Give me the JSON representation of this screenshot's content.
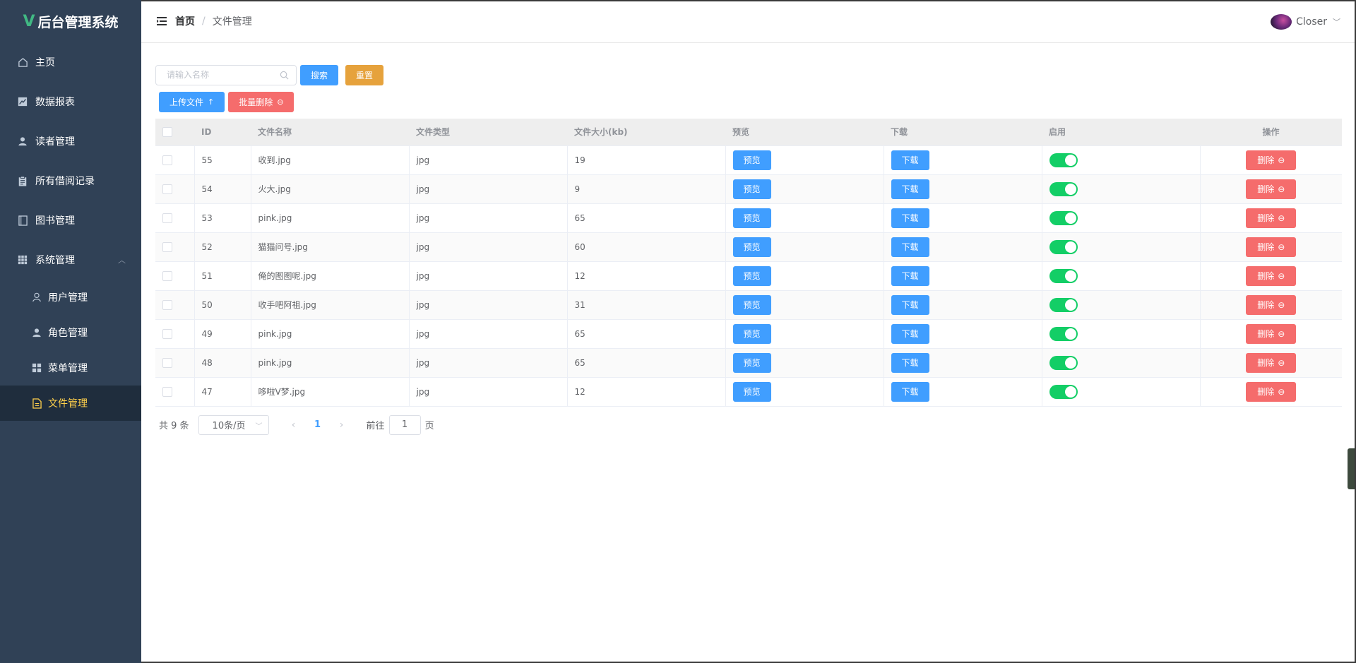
{
  "app": {
    "title": "后台管理系统",
    "logo_letter": "V"
  },
  "sidebar": {
    "items": [
      {
        "label": "主页",
        "icon": "home-icon"
      },
      {
        "label": "数据报表",
        "icon": "chart-icon"
      },
      {
        "label": "读者管理",
        "icon": "user-icon"
      },
      {
        "label": "所有借阅记录",
        "icon": "clipboard-icon"
      },
      {
        "label": "图书管理",
        "icon": "book-icon"
      },
      {
        "label": "系统管理",
        "icon": "grid-icon",
        "expanded": true
      }
    ],
    "sub_items": [
      {
        "label": "用户管理",
        "icon": "user-outline-icon"
      },
      {
        "label": "角色管理",
        "icon": "user-solid-icon"
      },
      {
        "label": "菜单管理",
        "icon": "menu-grid-icon"
      },
      {
        "label": "文件管理",
        "icon": "document-icon",
        "active": true
      }
    ]
  },
  "header": {
    "breadcrumb": {
      "home": "首页",
      "separator": "/",
      "current": "文件管理"
    },
    "user": {
      "name": "Closer"
    }
  },
  "toolbar": {
    "search_placeholder": "请输入名称",
    "search_value": "",
    "search_label": "搜索",
    "reset_label": "重置",
    "upload_label": "上传文件",
    "batch_delete_label": "批量删除"
  },
  "table": {
    "headers": {
      "id": "ID",
      "name": "文件名称",
      "type": "文件类型",
      "size": "文件大小(kb)",
      "preview": "预览",
      "download": "下载",
      "enable": "启用",
      "actions": "操作"
    },
    "buttons": {
      "preview": "预览",
      "download": "下载",
      "delete": "删除"
    },
    "rows": [
      {
        "id": "55",
        "name": "收到.jpg",
        "type": "jpg",
        "size": "19",
        "enabled": true
      },
      {
        "id": "54",
        "name": "火大.jpg",
        "type": "jpg",
        "size": "9",
        "enabled": true
      },
      {
        "id": "53",
        "name": "pink.jpg",
        "type": "jpg",
        "size": "65",
        "enabled": true
      },
      {
        "id": "52",
        "name": "猫猫问号.jpg",
        "type": "jpg",
        "size": "60",
        "enabled": true
      },
      {
        "id": "51",
        "name": "俺的图图呢.jpg",
        "type": "jpg",
        "size": "12",
        "enabled": true
      },
      {
        "id": "50",
        "name": "收手吧阿祖.jpg",
        "type": "jpg",
        "size": "31",
        "enabled": true
      },
      {
        "id": "49",
        "name": "pink.jpg",
        "type": "jpg",
        "size": "65",
        "enabled": true
      },
      {
        "id": "48",
        "name": "pink.jpg",
        "type": "jpg",
        "size": "65",
        "enabled": true
      },
      {
        "id": "47",
        "name": "哆啦V梦.jpg",
        "type": "jpg",
        "size": "12",
        "enabled": true
      }
    ]
  },
  "pagination": {
    "total_text": "共 9 条",
    "page_size": "10条/页",
    "current_page": "1",
    "goto_prefix": "前往",
    "goto_value": "1",
    "goto_suffix": "页"
  },
  "colors": {
    "sidebar_bg": "#304156",
    "active_text": "#ffd04b",
    "primary": "#409eff",
    "warning": "#e6a23c",
    "danger": "#f56c6c",
    "switch_on": "#13ce66"
  }
}
